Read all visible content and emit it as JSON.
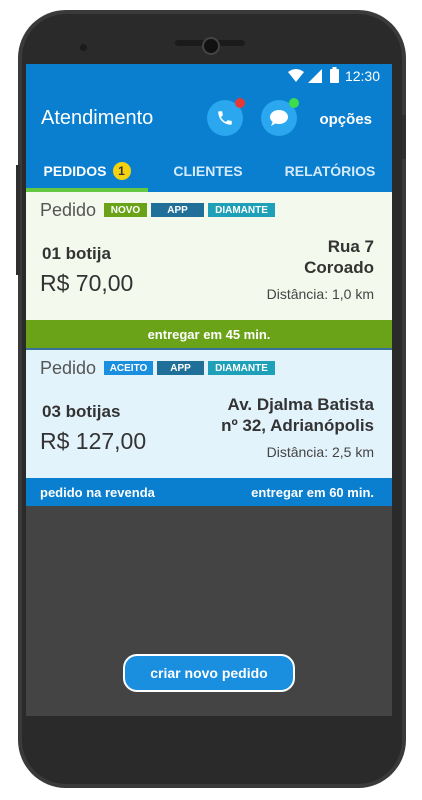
{
  "status": {
    "time": "12:30"
  },
  "header": {
    "title": "Atendimento",
    "options_label": "opções"
  },
  "colors": {
    "primary": "#0a7fd0",
    "green": "#6aa317",
    "call_dot": "#e53935",
    "msg_dot": "#3ddc4c"
  },
  "tabs": [
    {
      "label": "PEDIDOS",
      "badge": "1",
      "active": true
    },
    {
      "label": "CLIENTES",
      "active": false
    },
    {
      "label": "RELATÓRIOS",
      "active": false
    }
  ],
  "orders": [
    {
      "label": "Pedido",
      "tags": [
        "NOVO",
        "APP",
        "DIAMANTE"
      ],
      "quantity": "01  botija",
      "price": "R$ 70,00",
      "address_line1": "Rua 7",
      "address_line2": "Coroado",
      "distance": "Distância: 1,0 km",
      "footer_left": "",
      "footer_right": "entregar em 45 min."
    },
    {
      "label": "Pedido",
      "tags": [
        "ACEITO",
        "APP",
        "DIAMANTE"
      ],
      "quantity": "03  botijas",
      "price": "R$ 127,00",
      "address_line1": "Av. Djalma Batista",
      "address_line2": "nº 32, Adrianópolis",
      "distance": "Distância: 2,5 km",
      "footer_left": "pedido na revenda",
      "footer_right": "entregar em 60 min."
    }
  ],
  "actions": {
    "create_order": "criar novo pedido"
  },
  "icons": {
    "call": "phone-icon",
    "chat": "chat-icon"
  }
}
